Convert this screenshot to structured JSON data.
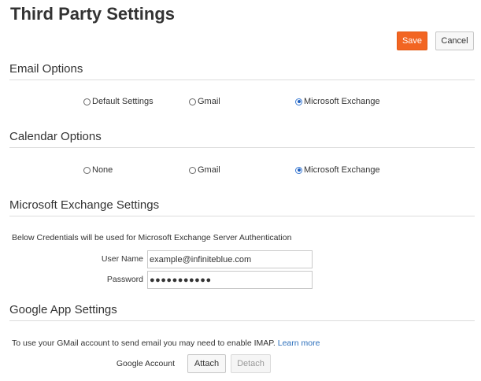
{
  "page": {
    "title": "Third Party Settings"
  },
  "toolbar": {
    "save_label": "Save",
    "cancel_label": "Cancel"
  },
  "email_options": {
    "title": "Email Options",
    "options": [
      "Default Settings",
      "Gmail",
      "Microsoft Exchange"
    ],
    "selected": "Microsoft Exchange"
  },
  "calendar_options": {
    "title": "Calendar Options",
    "options": [
      "None",
      "Gmail",
      "Microsoft Exchange"
    ],
    "selected": "Microsoft Exchange"
  },
  "exchange_settings": {
    "title": "Microsoft Exchange Settings",
    "note": "Below Credentials will be used for Microsoft Exchange Server Authentication",
    "username_label": "User Name",
    "username_value": "example@infiniteblue.com",
    "password_label": "Password",
    "password_value": "●●●●●●●●●●●"
  },
  "google_settings": {
    "title": "Google App Settings",
    "note": "To use your GMail account to send email you may need to enable IMAP.",
    "learn_more": "Learn more",
    "account_label": "Google Account",
    "attach_label": "Attach",
    "detach_label": "Detach"
  },
  "colors": {
    "accent": "#f26522",
    "link": "#2a6ebb",
    "radio_selected": "#1f5fbf"
  }
}
